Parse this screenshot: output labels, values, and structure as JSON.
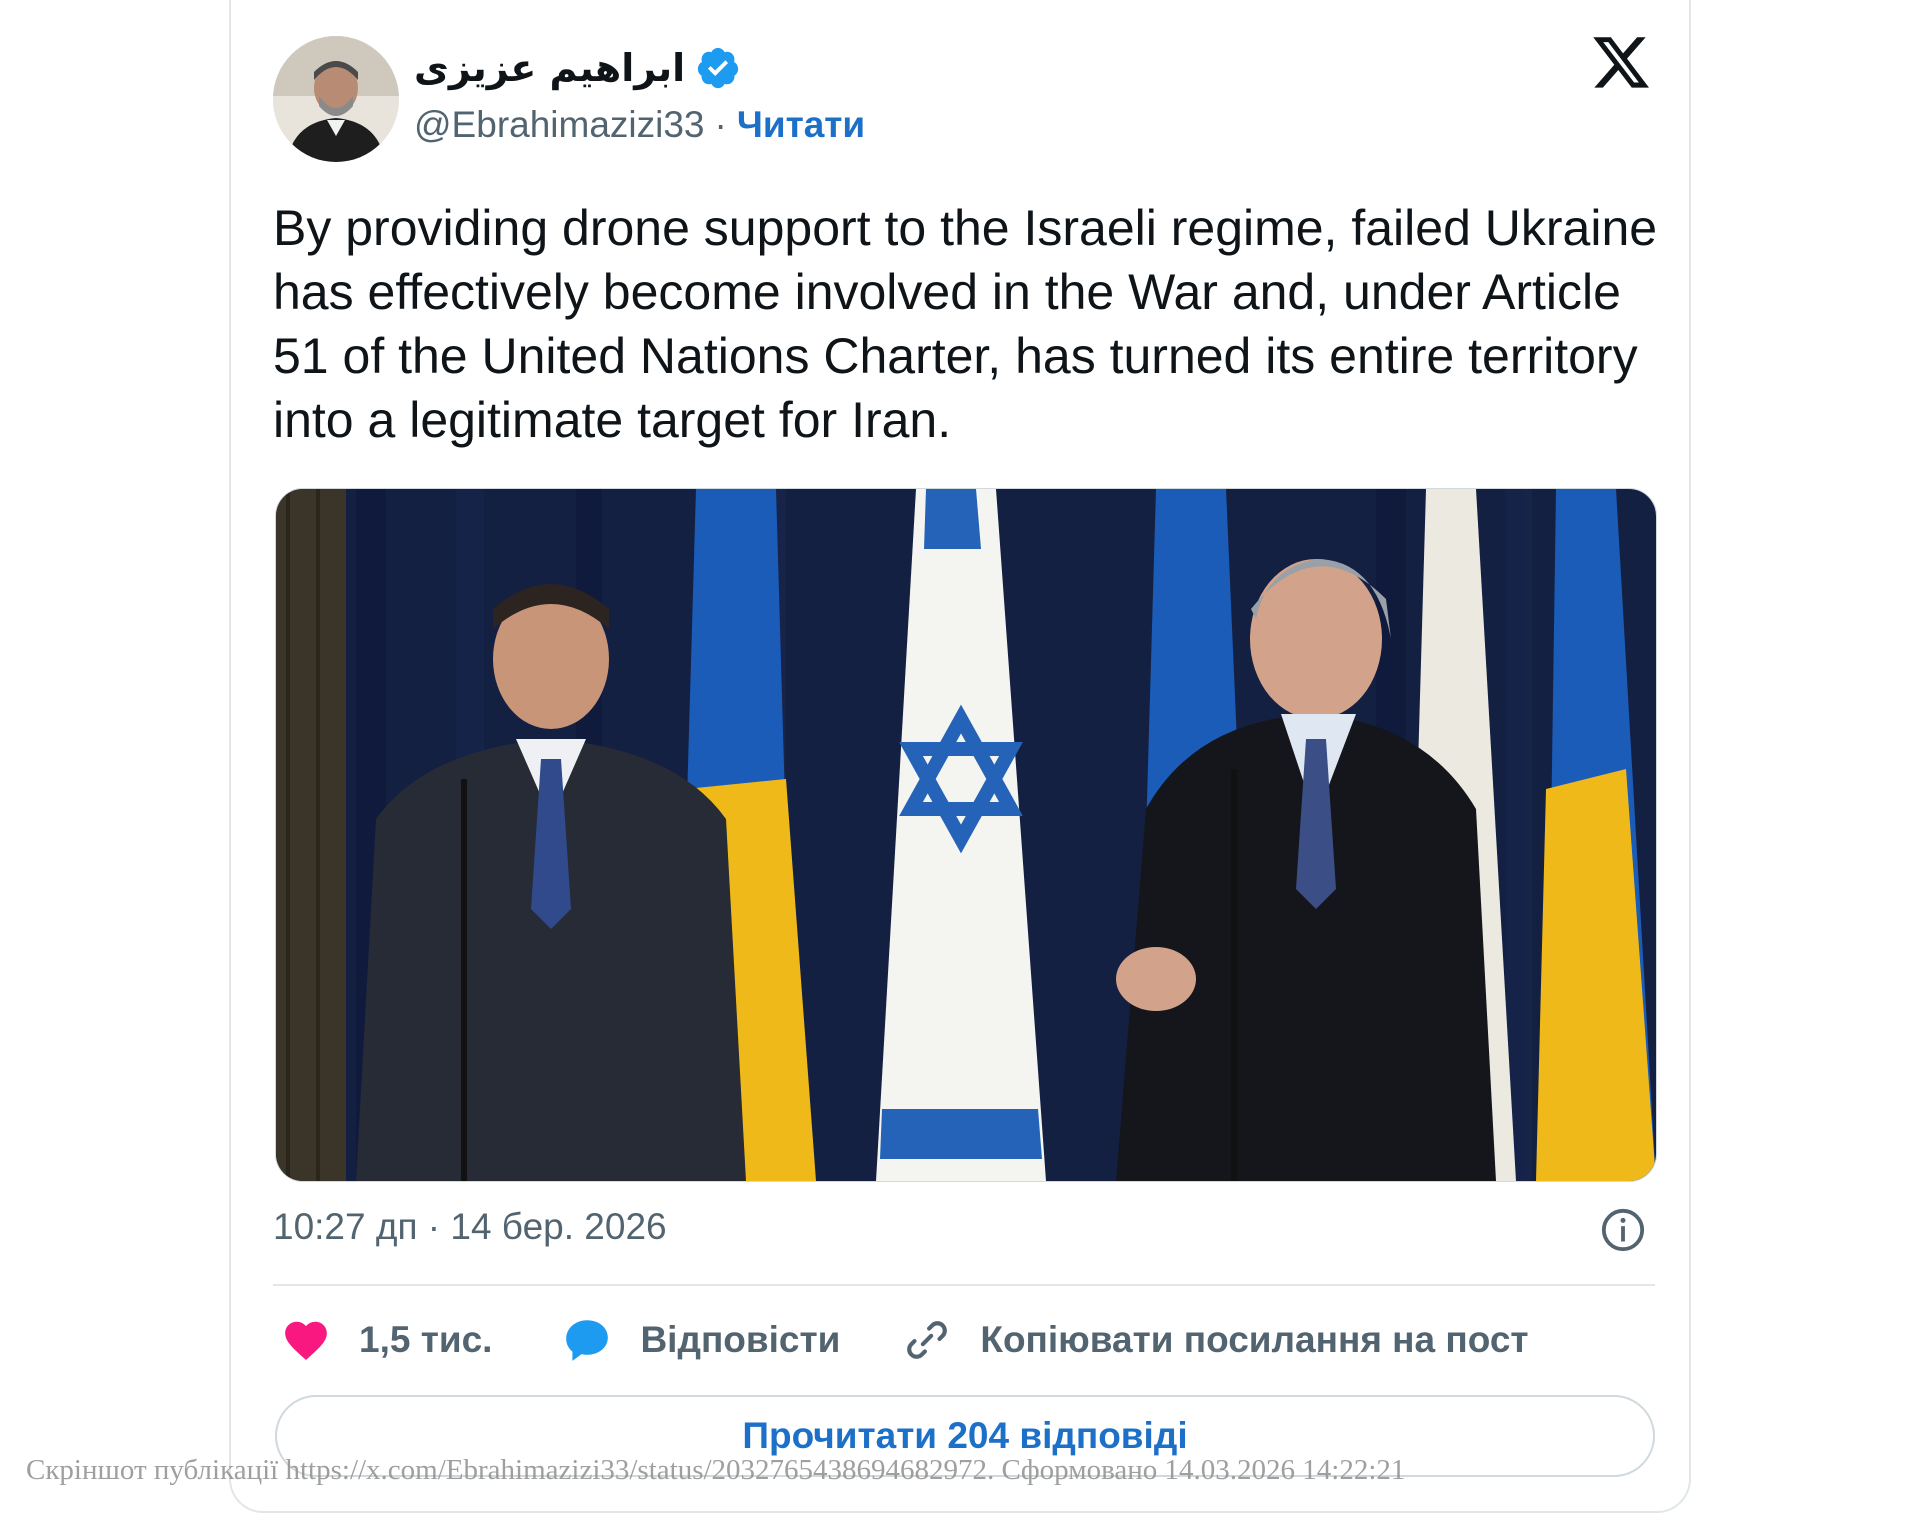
{
  "author": {
    "name": "ابراهیم عزیزی",
    "handle": "@Ebrahimazizi33",
    "separator": "·",
    "follow_label": "Читати",
    "verified_icon": "verified-badge-icon"
  },
  "platform_logo": "x-logo-icon",
  "tweet": {
    "text": "By providing drone support to the Israeli regime, failed Ukraine has effectively become involved in the War and, under Article 51 of the United Nations Charter, has turned its entire territory into a legitimate target for Iran.",
    "timestamp": "10:27 дп · 14 бер. 2026"
  },
  "actions": {
    "like_count": "1,5 тис.",
    "reply_label": "Відповісти",
    "copy_link_label": "Копіювати посилання на пост"
  },
  "read_replies_label": "Прочитати 204 відповіді",
  "watermark": "Скріншот публікації https://x.com/Ebrahimazizi33/status/2032765438694682972. Сформовано 14.03.2026 14:22:21",
  "colors": {
    "link": "#1d70c8",
    "verified": "#1d9bf0",
    "like": "#f91880",
    "text": "#0f1419",
    "muted": "#536471"
  }
}
